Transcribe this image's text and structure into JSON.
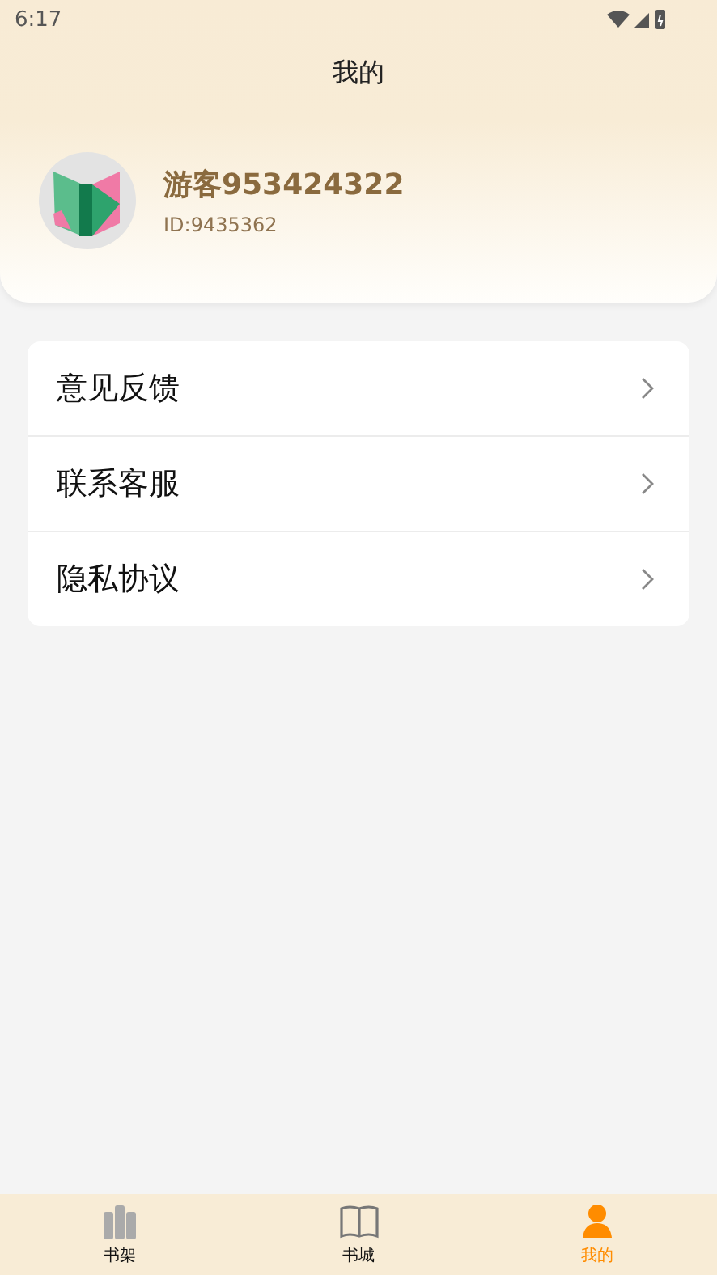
{
  "status_bar": {
    "time": "6:17"
  },
  "title": "我的",
  "profile": {
    "name": "游客953424322",
    "id": "ID:9435362"
  },
  "menu": [
    {
      "label": "意见反馈"
    },
    {
      "label": "联系客服"
    },
    {
      "label": "隐私协议"
    }
  ],
  "tabs": [
    {
      "label": "书架",
      "kind": "shelf",
      "selected": false
    },
    {
      "label": "书城",
      "kind": "book",
      "selected": false
    },
    {
      "label": "我的",
      "kind": "person",
      "selected": true
    }
  ]
}
